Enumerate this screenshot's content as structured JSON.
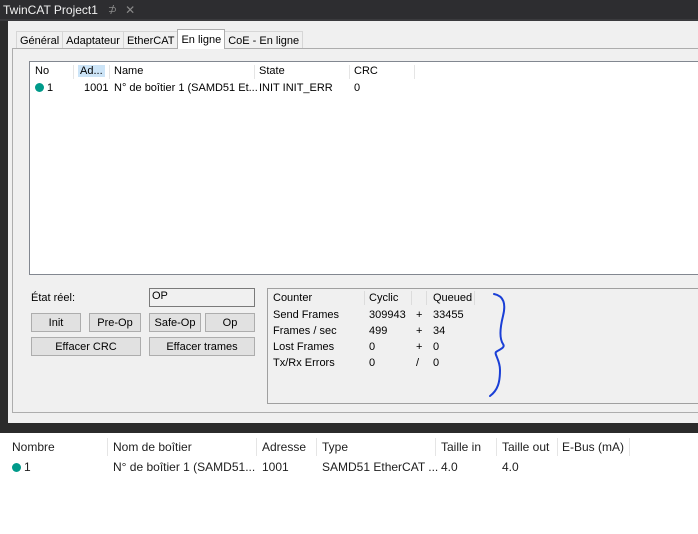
{
  "title": {
    "text": "TwinCAT Project1",
    "pin": "⊅",
    "close": "✕"
  },
  "tabs": [
    {
      "label": "Général"
    },
    {
      "label": "Adaptateur"
    },
    {
      "label": "EtherCAT"
    },
    {
      "label": "En ligne"
    },
    {
      "label": "CoE - En ligne"
    }
  ],
  "devlist": {
    "columns": [
      "No",
      "Ad...",
      "Name",
      "State",
      "CRC"
    ],
    "row": {
      "no": "1",
      "addr": "1001",
      "name": "N° de boîtier 1 (SAMD51 Et...",
      "state": "INIT INIT_ERR",
      "crc": "0"
    }
  },
  "state": {
    "label": "État réel:",
    "value": "OP"
  },
  "buttons": {
    "init": "Init",
    "preop": "Pre-Op",
    "safeop": "Safe-Op",
    "op": "Op",
    "clear_crc": "Effacer CRC",
    "clear_frames": "Effacer trames"
  },
  "counter": {
    "headers": {
      "counter": "Counter",
      "cyclic": "Cyclic",
      "queued": "Queued"
    },
    "rows": [
      {
        "label": "Send Frames",
        "cyclic": "309943",
        "op": "+",
        "queued": "33455"
      },
      {
        "label": "Frames / sec",
        "cyclic": "499",
        "op": "+",
        "queued": "34"
      },
      {
        "label": "Lost Frames",
        "cyclic": "0",
        "op": "+",
        "queued": "0"
      },
      {
        "label": "Tx/Rx Errors",
        "cyclic": "0",
        "op": "/",
        "queued": "0"
      }
    ]
  },
  "bottom": {
    "columns": [
      "Nombre",
      "Nom de boîtier",
      "Adresse",
      "Type",
      "Taille in",
      "Taille out",
      "E-Bus (mA)"
    ],
    "row": {
      "nombre": "1",
      "nom": "N° de boîtier 1 (SAMD51...",
      "adresse": "1001",
      "type": "SAMD51 EtherCAT ...",
      "in": "4.0",
      "out": "4.0"
    }
  },
  "colors": {
    "status_dot": "#009a8a",
    "annotation": "#1a3fd6"
  }
}
